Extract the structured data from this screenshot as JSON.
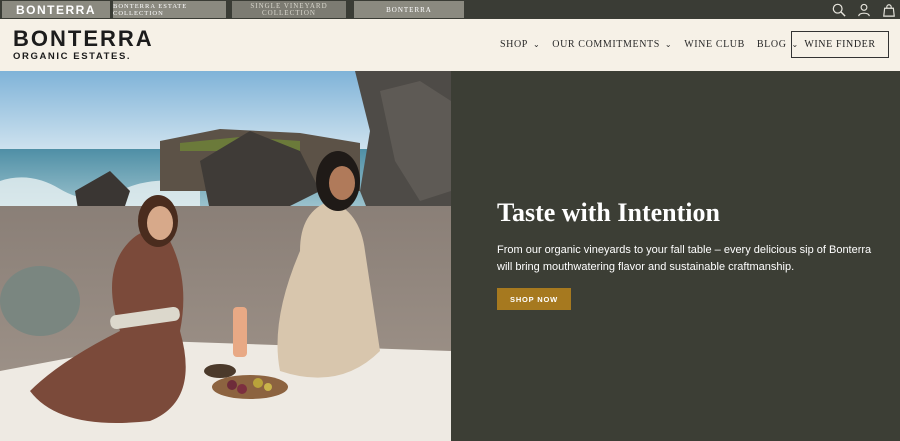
{
  "topbar": {
    "tabs": [
      {
        "label": "BONTERRA"
      },
      {
        "label": "BONTERRA ESTATE COLLECTION"
      },
      {
        "label": "SINGLE VINEYARD COLLECTION"
      },
      {
        "label": "BONTERRA"
      }
    ],
    "icons": [
      "search-icon",
      "account-icon",
      "cart-icon"
    ]
  },
  "nav": {
    "logo_main": "BONTERRA",
    "logo_sub": "ORGANIC ESTATES.",
    "menu": [
      {
        "label": "SHOP",
        "dropdown": true
      },
      {
        "label": "OUR COMMITMENTS",
        "dropdown": true
      },
      {
        "label": "WINE CLUB",
        "dropdown": false
      },
      {
        "label": "BLOG",
        "dropdown": true
      }
    ],
    "cta": "WINE FINDER"
  },
  "hero": {
    "title": "Taste with Intention",
    "description": "From our organic vineyards to your fall table – every delicious sip of Bonterra will bring mouthwatering flavor and sustainable craftmanship.",
    "button": "SHOP NOW",
    "colors": {
      "panel": "#3c3e35",
      "button": "#a6791f",
      "nav_bg": "#f6f1e7"
    }
  }
}
